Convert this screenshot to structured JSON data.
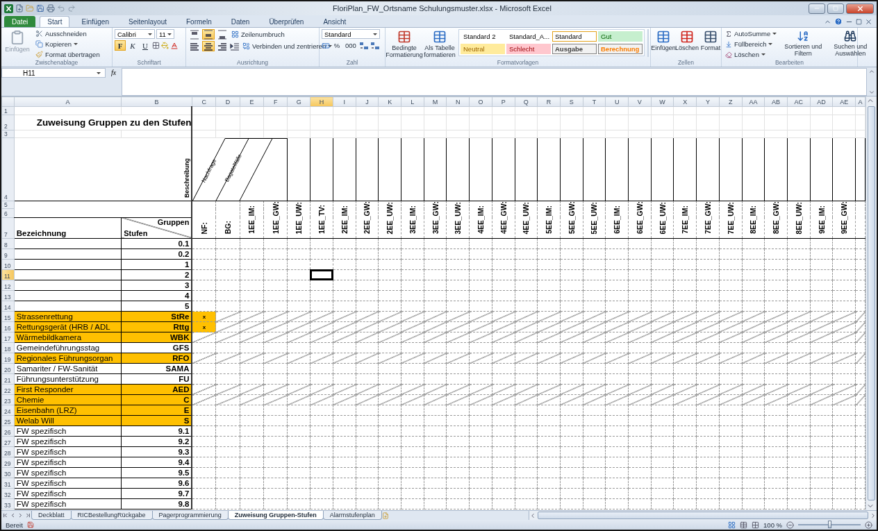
{
  "window": {
    "title": "FloriPlan_FW_Ortsname Schulungsmuster.xlsx - Microsoft Excel"
  },
  "ribbon_tabs": [
    {
      "label": "Datei",
      "kind": "file",
      "selected": false
    },
    {
      "label": "Start",
      "kind": "tab",
      "selected": true
    },
    {
      "label": "Einfügen",
      "kind": "tab",
      "selected": false
    },
    {
      "label": "Seitenlayout",
      "kind": "tab",
      "selected": false
    },
    {
      "label": "Formeln",
      "kind": "tab",
      "selected": false
    },
    {
      "label": "Daten",
      "kind": "tab",
      "selected": false
    },
    {
      "label": "Überprüfen",
      "kind": "tab",
      "selected": false
    },
    {
      "label": "Ansicht",
      "kind": "tab",
      "selected": false
    }
  ],
  "ribbon": {
    "clipboard": {
      "label": "Zwischenablage",
      "paste": {
        "label": "Einfügen",
        "disabled": true
      },
      "cut": "Ausschneiden",
      "copy": "Kopieren",
      "format_painter": "Format übertragen"
    },
    "font": {
      "label": "Schriftart",
      "font_name": "Calibri",
      "font_size": "11",
      "bold": {
        "label": "F",
        "selected": true
      },
      "italic": {
        "label": "K",
        "selected": false
      },
      "underline": {
        "label": "U",
        "selected": false
      }
    },
    "alignment": {
      "label": "Ausrichtung",
      "wrap_text": "Zeilenumbruch",
      "merge_center": "Verbinden und zentrieren",
      "vertical": [
        {
          "selected": false
        },
        {
          "selected": true
        },
        {
          "selected": false
        }
      ],
      "horizontal": [
        {
          "selected": false
        },
        {
          "selected": true
        },
        {
          "selected": false
        }
      ]
    },
    "number": {
      "label": "Zahl",
      "format": "Standard",
      "percent": "%",
      "thousands": "000"
    },
    "styles": {
      "label": "Formatvorlagen",
      "conditional": "Bedingte Formatierung",
      "as_table": "Als Tabelle formatieren",
      "gallery": [
        {
          "label": "Standard 2",
          "kind": "plain",
          "color": "#ffffff",
          "selected": false
        },
        {
          "label": "Standard_A...",
          "kind": "plain",
          "color": "#ffffff",
          "selected": false
        },
        {
          "label": "Standard",
          "kind": "plain",
          "color": "#ffffff",
          "selected": true
        },
        {
          "label": "Gut",
          "kind": "good",
          "color": "#c6efce",
          "selected": false
        },
        {
          "label": "Neutral",
          "kind": "neutral",
          "color": "#ffeb9c",
          "selected": false
        },
        {
          "label": "Schlecht",
          "kind": "bad",
          "color": "#ffc7ce",
          "selected": false
        },
        {
          "label": "Ausgabe",
          "kind": "output",
          "color": "#f2f2f2",
          "selected": false
        },
        {
          "label": "Berechnung",
          "kind": "calculation",
          "color": "#f2f2f2",
          "selected": false
        }
      ]
    },
    "cells": {
      "label": "Zellen",
      "insert": "Einfügen",
      "delete": "Löschen",
      "format": "Format"
    },
    "editing": {
      "label": "Bearbeiten",
      "autosum": "AutoSumme",
      "fill": "Füllbereich",
      "clear": "Löschen",
      "sort": "Sortieren und Filtern",
      "find": "Suchen und Auswählen"
    }
  },
  "formula_bar": {
    "name_box": "H11",
    "function_label": "fx"
  },
  "sheet": {
    "columns": [
      {
        "label": "A",
        "selected": false
      },
      {
        "label": "B",
        "selected": false
      },
      {
        "label": "C",
        "selected": false
      },
      {
        "label": "D",
        "selected": false
      },
      {
        "label": "E",
        "selected": false
      },
      {
        "label": "F",
        "selected": false
      },
      {
        "label": "G",
        "selected": false
      },
      {
        "label": "H",
        "selected": true
      },
      {
        "label": "I",
        "selected": false
      },
      {
        "label": "J",
        "selected": false
      },
      {
        "label": "K",
        "selected": false
      },
      {
        "label": "L",
        "selected": false
      },
      {
        "label": "M",
        "selected": false
      },
      {
        "label": "N",
        "selected": false
      },
      {
        "label": "O",
        "selected": false
      },
      {
        "label": "P",
        "selected": false
      },
      {
        "label": "Q",
        "selected": false
      },
      {
        "label": "R",
        "selected": false
      },
      {
        "label": "S",
        "selected": false
      },
      {
        "label": "T",
        "selected": false
      },
      {
        "label": "U",
        "selected": false
      },
      {
        "label": "V",
        "selected": false
      },
      {
        "label": "W",
        "selected": false
      },
      {
        "label": "X",
        "selected": false
      },
      {
        "label": "Y",
        "selected": false
      },
      {
        "label": "Z",
        "selected": false
      },
      {
        "label": "AA",
        "selected": false
      },
      {
        "label": "AB",
        "selected": false
      },
      {
        "label": "AC",
        "selected": false
      },
      {
        "label": "AD",
        "selected": false
      },
      {
        "label": "AE",
        "selected": false
      },
      {
        "label": "A",
        "selected": false
      }
    ],
    "header_rows": [
      {
        "number": "1",
        "selected": false
      },
      {
        "number": "2",
        "selected": false
      },
      {
        "number": "3",
        "selected": false
      },
      {
        "number": "4",
        "selected": false
      },
      {
        "number": "5",
        "selected": false
      },
      {
        "number": "6",
        "selected": false
      },
      {
        "number": "7",
        "selected": false
      }
    ],
    "title": "Zuweisung Gruppen zu den Stufen",
    "description_header": "Beschreibung",
    "slanted_headers": [
      "Nachfrage",
      "Bagatellfälle"
    ],
    "name_header": "Bezeichnung",
    "corner_header": {
      "top": "Gruppen",
      "bottom": "Stufen"
    },
    "group_headers": [
      "NF:",
      "BG:",
      "1EE_IM:",
      "1EE_GW:",
      "1EE_UW:",
      "1EE_TV:",
      "2EE_IM:",
      "2EE_GW:",
      "2EE_UW:",
      "3EE_IM:",
      "3EE_GW:",
      "3EE_UW:",
      "4EE_IM:",
      "4EE_GW:",
      "4EE_UW:",
      "5EE_IM:",
      "5EE_GW:",
      "5EE_UW:",
      "6EE_IM:",
      "6EE_GW:",
      "6EE_UW:",
      "7EE_IM:",
      "7EE_GW:",
      "7EE_UW:",
      "8EE_IM:",
      "8EE_GW:",
      "8EE_UW:",
      "9EE_IM:",
      "9EE_GW:"
    ],
    "rows": [
      {
        "number": "8",
        "selected": false,
        "code": "0.1",
        "highlighted": false,
        "struck": false
      },
      {
        "number": "9",
        "selected": false,
        "code": "0.2",
        "highlighted": false,
        "struck": false
      },
      {
        "number": "10",
        "selected": false,
        "code": "1",
        "highlighted": false,
        "struck": false
      },
      {
        "number": "11",
        "selected": true,
        "code": "2",
        "highlighted": false,
        "struck": false
      },
      {
        "number": "12",
        "selected": false,
        "code": "3",
        "highlighted": false,
        "struck": false
      },
      {
        "number": "13",
        "selected": false,
        "code": "4",
        "highlighted": false,
        "struck": false
      },
      {
        "number": "14",
        "selected": false,
        "code": "5",
        "highlighted": false,
        "struck": false
      },
      {
        "number": "15",
        "selected": false,
        "name": "Strassenrettung",
        "code": "StRe",
        "highlighted": true,
        "nf": "x",
        "struck": true
      },
      {
        "number": "16",
        "selected": false,
        "name": "Rettungsgerät (HRB / ADL",
        "code": "Rttg",
        "highlighted": true,
        "nf": "x",
        "struck": true
      },
      {
        "number": "17",
        "selected": false,
        "name": "Wärmebildkamera",
        "code": "WBK",
        "highlighted": true,
        "struck": true
      },
      {
        "number": "18",
        "selected": false,
        "name": "Gemeindeführungsstag",
        "code": "GFS",
        "highlighted": false,
        "struck": false
      },
      {
        "number": "19",
        "selected": false,
        "name": "Regionales Führungsorgan",
        "code": "RFO",
        "highlighted": true,
        "struck": true
      },
      {
        "number": "20",
        "selected": false,
        "name": "Samariter / FW-Sanität",
        "code": "SAMA",
        "highlighted": false,
        "struck": false
      },
      {
        "number": "21",
        "selected": false,
        "name": "Führungsunterstützung",
        "code": "FU",
        "highlighted": false,
        "struck": false
      },
      {
        "number": "22",
        "selected": false,
        "name": "First Responder",
        "code": "AED",
        "highlighted": true,
        "struck": true
      },
      {
        "number": "23",
        "selected": false,
        "name": "Chemie",
        "code": "C",
        "highlighted": true,
        "struck": true
      },
      {
        "number": "24",
        "selected": false,
        "name": "Eisenbahn (LRZ)",
        "code": "E",
        "highlighted": true,
        "struck": false
      },
      {
        "number": "25",
        "selected": false,
        "name": "Welab Will",
        "code": "S",
        "highlighted": true,
        "struck": false
      },
      {
        "number": "26",
        "selected": false,
        "name": "FW spezifisch",
        "code": "9.1",
        "highlighted": false,
        "struck": false
      },
      {
        "number": "27",
        "selected": false,
        "name": "FW spezifisch",
        "code": "9.2",
        "highlighted": false,
        "struck": false
      },
      {
        "number": "28",
        "selected": false,
        "name": "FW spezifisch",
        "code": "9.3",
        "highlighted": false,
        "struck": false
      },
      {
        "number": "29",
        "selected": false,
        "name": "FW spezifisch",
        "code": "9.4",
        "highlighted": false,
        "struck": false
      },
      {
        "number": "30",
        "selected": false,
        "name": "FW spezifisch",
        "code": "9.5",
        "highlighted": false,
        "struck": false
      },
      {
        "number": "31",
        "selected": false,
        "name": "FW spezifisch",
        "code": "9.6",
        "highlighted": false,
        "struck": false
      },
      {
        "number": "32",
        "selected": false,
        "name": "FW spezifisch",
        "code": "9.7",
        "highlighted": false,
        "struck": false
      },
      {
        "number": "33",
        "selected": false,
        "name": "FW spezifisch",
        "code": "9.8",
        "highlighted": false,
        "struck": false
      }
    ]
  },
  "sheet_tabs": [
    {
      "label": "Deckblatt",
      "selected": false
    },
    {
      "label": "RICBestellungRückgabe",
      "selected": false
    },
    {
      "label": "Pagerprogrammierung",
      "selected": false
    },
    {
      "label": "Zuweisung Gruppen-Stufen",
      "selected": true
    },
    {
      "label": "Alarmstufenplan",
      "selected": false
    }
  ],
  "status_bar": {
    "text": "Bereit",
    "zoom": "100 %",
    "zoom_slider": {
      "level": 0.5
    }
  }
}
